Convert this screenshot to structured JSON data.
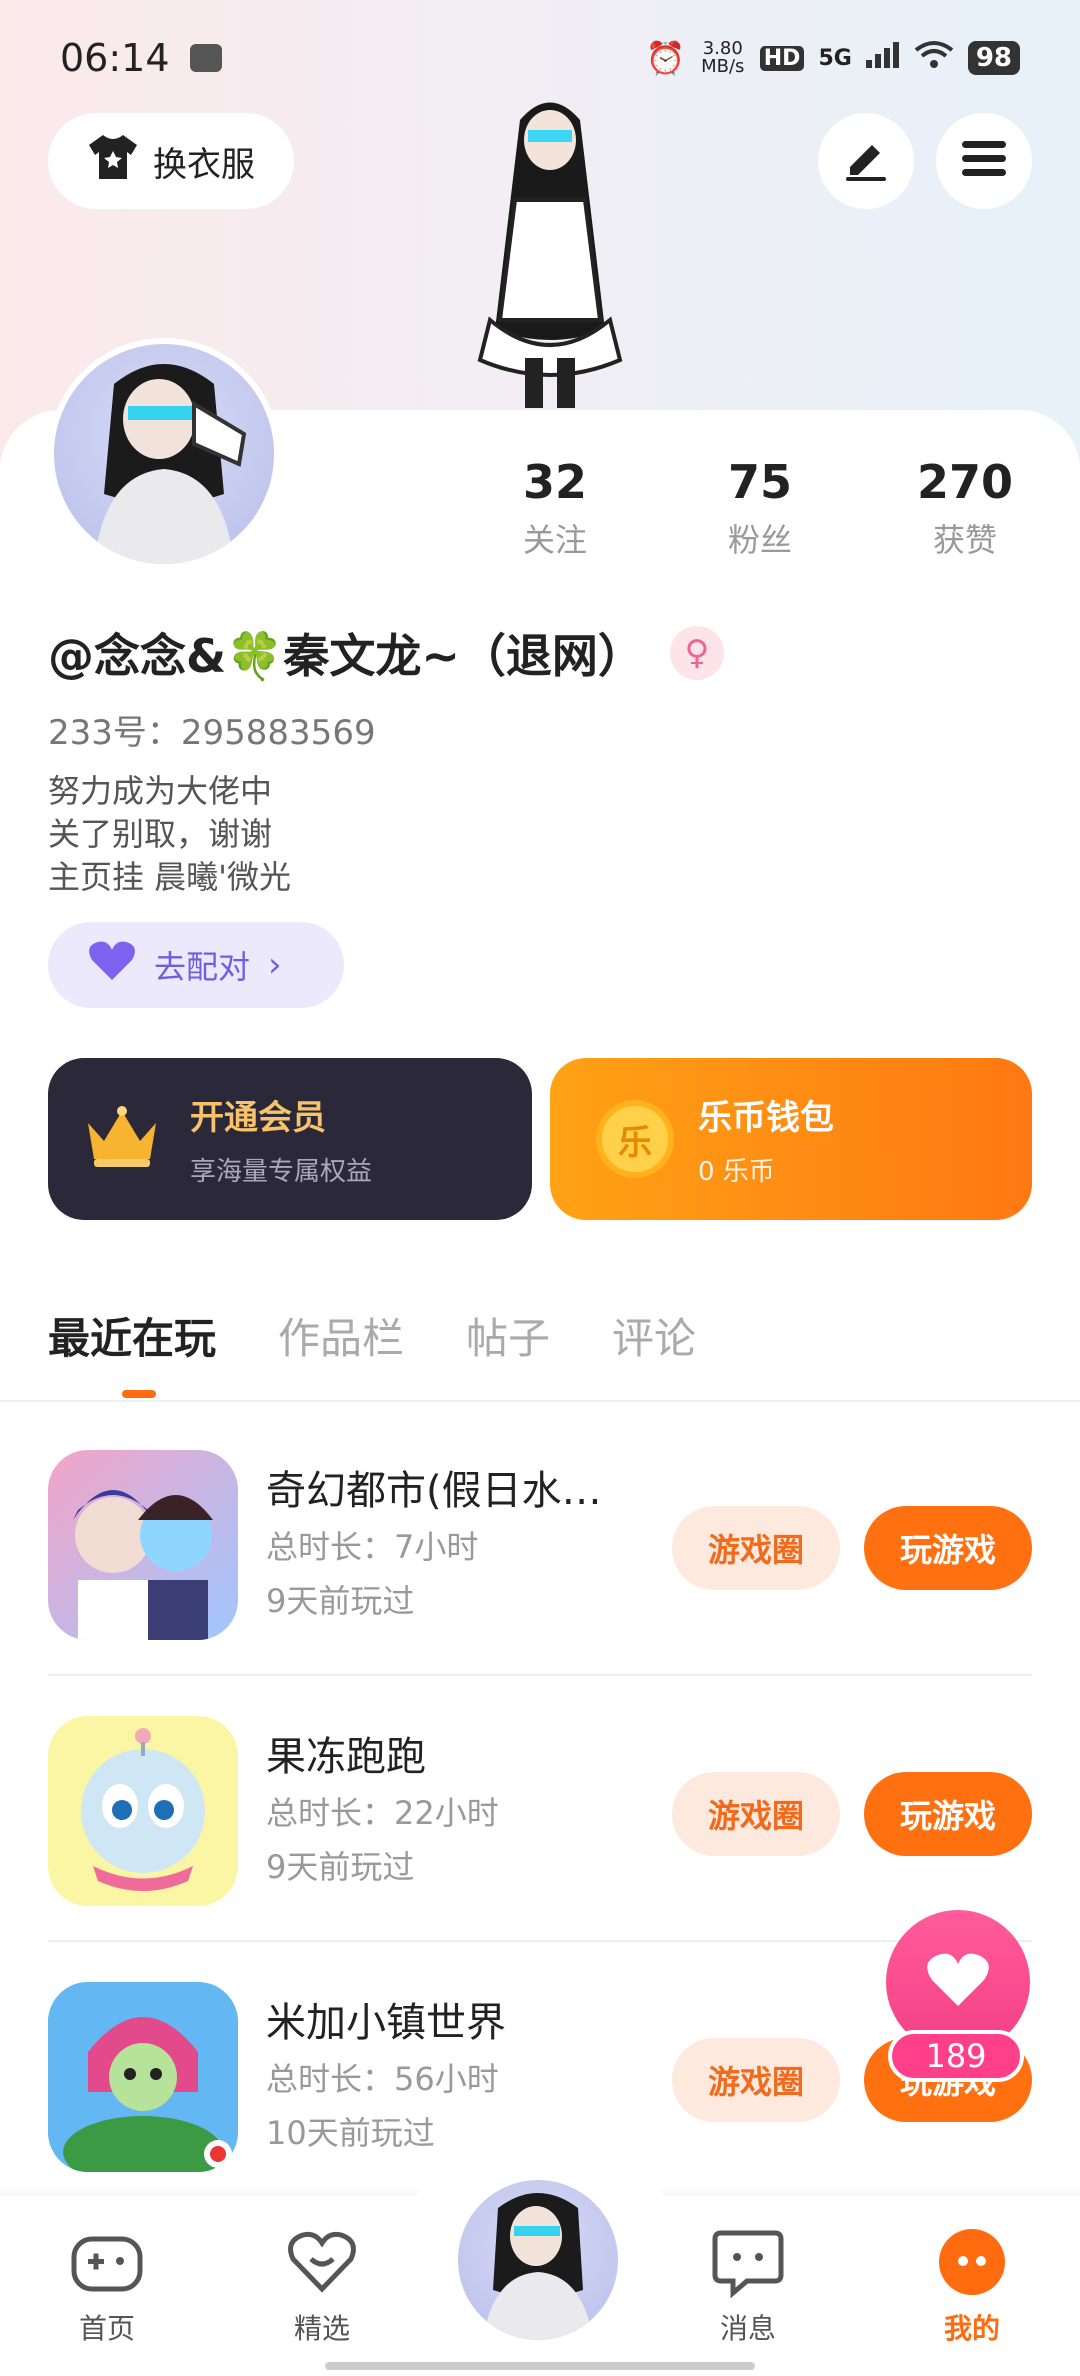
{
  "status_bar": {
    "time": "06:14",
    "net_speed": "3.80 MB/s",
    "hd": "HD",
    "signal": "5G",
    "battery": "98"
  },
  "header": {
    "outfit_label": "换衣服"
  },
  "profile": {
    "stats": [
      {
        "value": "32",
        "label": "关注"
      },
      {
        "value": "75",
        "label": "粉丝"
      },
      {
        "value": "270",
        "label": "获赞"
      }
    ],
    "username": "@念念&🍀秦文龙~（退网）",
    "gender_symbol": "♀",
    "id_line": "233号：295883569",
    "bio": [
      "努力成为大佬中",
      "关了别取，谢谢",
      "主页挂  晨曦'微光"
    ],
    "match_label": "去配对"
  },
  "cards": {
    "vip": {
      "title": "开通会员",
      "subtitle": "享海量专属权益"
    },
    "wallet": {
      "badge": "乐",
      "title": "乐币钱包",
      "subtitle": "0 乐币"
    }
  },
  "tabs": [
    "最近在玩",
    "作品栏",
    "帖子",
    "评论"
  ],
  "games": [
    {
      "name": "奇幻都市(假日水…",
      "time": "总时长：7小时",
      "ago": "9天前玩过"
    },
    {
      "name": "果冻跑跑",
      "time": "总时长：22小时",
      "ago": "9天前玩过"
    },
    {
      "name": "米加小镇世界",
      "time": "总时长：56小时",
      "ago": "10天前玩过"
    }
  ],
  "game_buttons": {
    "circle": "游戏圈",
    "play": "玩游戏"
  },
  "floating_like": {
    "count": "189"
  },
  "bottom_nav": {
    "home": "首页",
    "featured": "精选",
    "messages": "消息",
    "mine": "我的"
  },
  "colors": {
    "accent": "#ff7011",
    "vip_bg": "#2b2839",
    "like": "#f43f86"
  }
}
